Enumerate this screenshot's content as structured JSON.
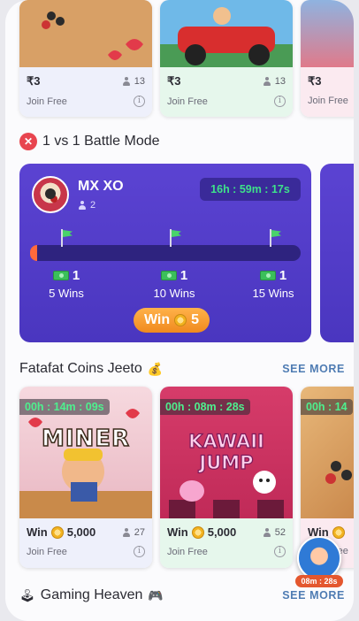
{
  "top_cards": [
    {
      "price": "₹3",
      "players": "13",
      "join": "Join Free",
      "foot_color": "#eef0fb"
    },
    {
      "price": "₹3",
      "players": "13",
      "join": "Join Free",
      "foot_color": "#e6f7ec"
    },
    {
      "price": "₹3",
      "join": "Join Free",
      "foot_color": "#fbeaf0"
    }
  ],
  "battle_section": {
    "title": "1 vs 1 Battle Mode",
    "card": {
      "game_name": "MX XO",
      "players": "2",
      "timer": "16h : 59m : 17s",
      "progress": 0.0,
      "milestones": [
        {
          "prize": "1",
          "label": "5 Wins"
        },
        {
          "prize": "1",
          "label": "10 Wins"
        },
        {
          "prize": "1",
          "label": "15 Wins"
        }
      ],
      "win_label": "Win",
      "win_amount": "5"
    }
  },
  "fatafat_section": {
    "title": "Fatafat Coins Jeeto",
    "see_more": "SEE MORE",
    "games": [
      {
        "timer": "00h : 14m : 09s",
        "art_title": "MINER",
        "win_label": "Win",
        "win_amount": "5,000",
        "players": "27",
        "join": "Join Free",
        "foot_color": "#eef0fb"
      },
      {
        "timer": "00h : 08m : 28s",
        "art_title": "KAWAII JUMP",
        "win_label": "Win",
        "win_amount": "5,000",
        "players": "52",
        "join": "Join Free",
        "foot_color": "#e6f7ec"
      },
      {
        "timer": "00h : 14",
        "win_label": "Win",
        "join": "Join Free",
        "foot_color": "#fbeaf0"
      }
    ]
  },
  "gaming_heaven_section": {
    "title": "Gaming Heaven",
    "see_more": "SEE MORE"
  },
  "floating_timer": {
    "label": "08m : 28s"
  }
}
